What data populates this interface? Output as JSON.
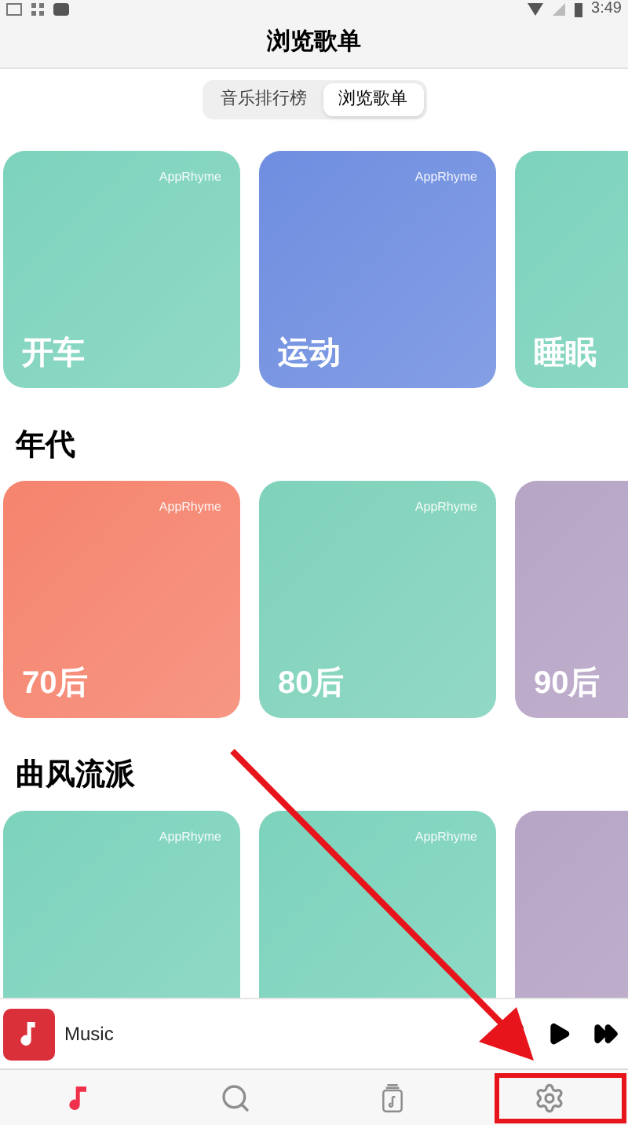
{
  "status_bar": {
    "time": "3:49"
  },
  "header": {
    "title": "浏览歌单"
  },
  "segments": [
    {
      "label": "音乐排行榜",
      "selected": false
    },
    {
      "label": "浏览歌单",
      "selected": true
    }
  ],
  "sections": [
    {
      "cards": [
        {
          "title": "开车",
          "brand": "AppRhyme",
          "color": "#7dd3bd"
        },
        {
          "title": "运动",
          "brand": "AppRhyme",
          "color": "#6f8ee0"
        },
        {
          "title": "睡眠",
          "color": "#7dd3bd"
        }
      ]
    },
    {
      "title": "年代",
      "cards": [
        {
          "title": "70后",
          "brand": "AppRhyme",
          "color": "#f5846e"
        },
        {
          "title": "80后",
          "brand": "AppRhyme",
          "color": "#7fd2bb"
        },
        {
          "title": "90后",
          "color": "#b7a5c6"
        }
      ]
    },
    {
      "title": "曲风流派",
      "cards": [
        {
          "brand": "AppRhyme",
          "color": "#7dd3bd"
        },
        {
          "brand": "AppRhyme",
          "color": "#7dd3bd"
        },
        {
          "color": "#b7a5c6"
        }
      ]
    }
  ],
  "player": {
    "title": "Music"
  },
  "tabs": [
    {
      "kind": "music",
      "selected": true
    },
    {
      "kind": "search",
      "selected": false
    },
    {
      "kind": "library",
      "selected": false
    },
    {
      "kind": "settings",
      "selected": false
    }
  ]
}
